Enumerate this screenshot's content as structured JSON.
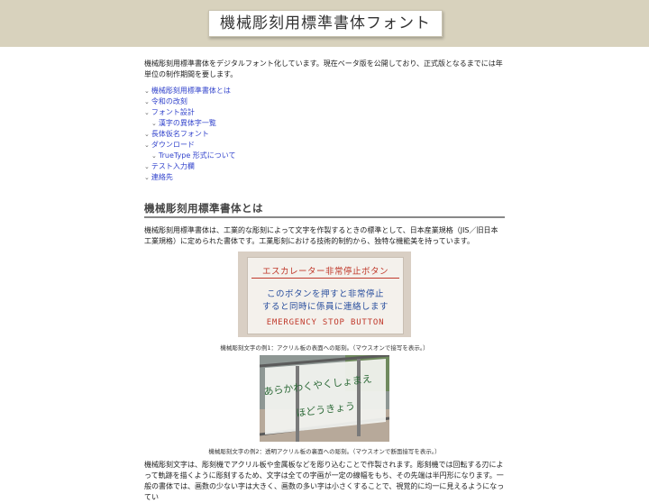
{
  "header": {
    "title": "機械彫刻用標準書体フォント"
  },
  "intro": "機械彫刻用標準書体をデジタルフォント化しています。現在ベータ版を公開しており、正式版となるまでには年単位の制作期間を要します。",
  "toc": [
    {
      "label": "機械彫刻用標準書体とは",
      "level": 1
    },
    {
      "label": "令和の改刻",
      "level": 1
    },
    {
      "label": "フォント設計",
      "level": 1
    },
    {
      "label": "漢字の異体字一覧",
      "level": 2
    },
    {
      "label": "長体仮名フォント",
      "level": 1
    },
    {
      "label": "ダウンロード",
      "level": 1
    },
    {
      "label": "TrueType 形式について",
      "level": 2
    },
    {
      "label": "テスト入力欄",
      "level": 1
    },
    {
      "label": "連絡先",
      "level": 1
    }
  ],
  "section1": {
    "heading": "機械彫刻用標準書体とは",
    "para1": "機械彫刻用標準書体は、工業的な彫刻によって文字を作製するときの標準として、日本産業規格（JIS／旧日本工業規格）に定められた書体です。工業彫刻における技術的制約から、独特な機能美を持っています。",
    "figure1": {
      "line1": "エスカレーター非常停止ボタン",
      "line2": "このボタンを押すと非常停止",
      "line3": "すると同時に係員に連絡します",
      "line4": "EMERGENCY STOP BUTTON",
      "caption": "機械彫刻文字の例1：アクリル板の表面への彫刻。（マウスオンで接写を表示。）"
    },
    "figure2": {
      "line1": "あらかわくやくしょまえ",
      "line2": "ほどうきょう",
      "caption": "機械彫刻文字の例2：透明アクリル板の裏面への彫刻。（マウスオンで断面接写を表示。）"
    },
    "para2": "機械彫刻文字は、彫刻機でアクリル板や金属板などを彫り込むことで作製されます。彫刻機では回転する刃によって軌跡を描くように彫刻するため、文字は全ての字画が一定の線幅をもち、その先端は半円形になります。一般の書体では、画数の少ない字は大きく、画数の多い字は小さくすることで、視覚的に均一に見えるようになってい"
  },
  "colors": {
    "header_bg": "#d8d2bd",
    "link": "#3344cc",
    "sign_red": "#c0392b",
    "sign_blue": "#2a4f9e"
  }
}
